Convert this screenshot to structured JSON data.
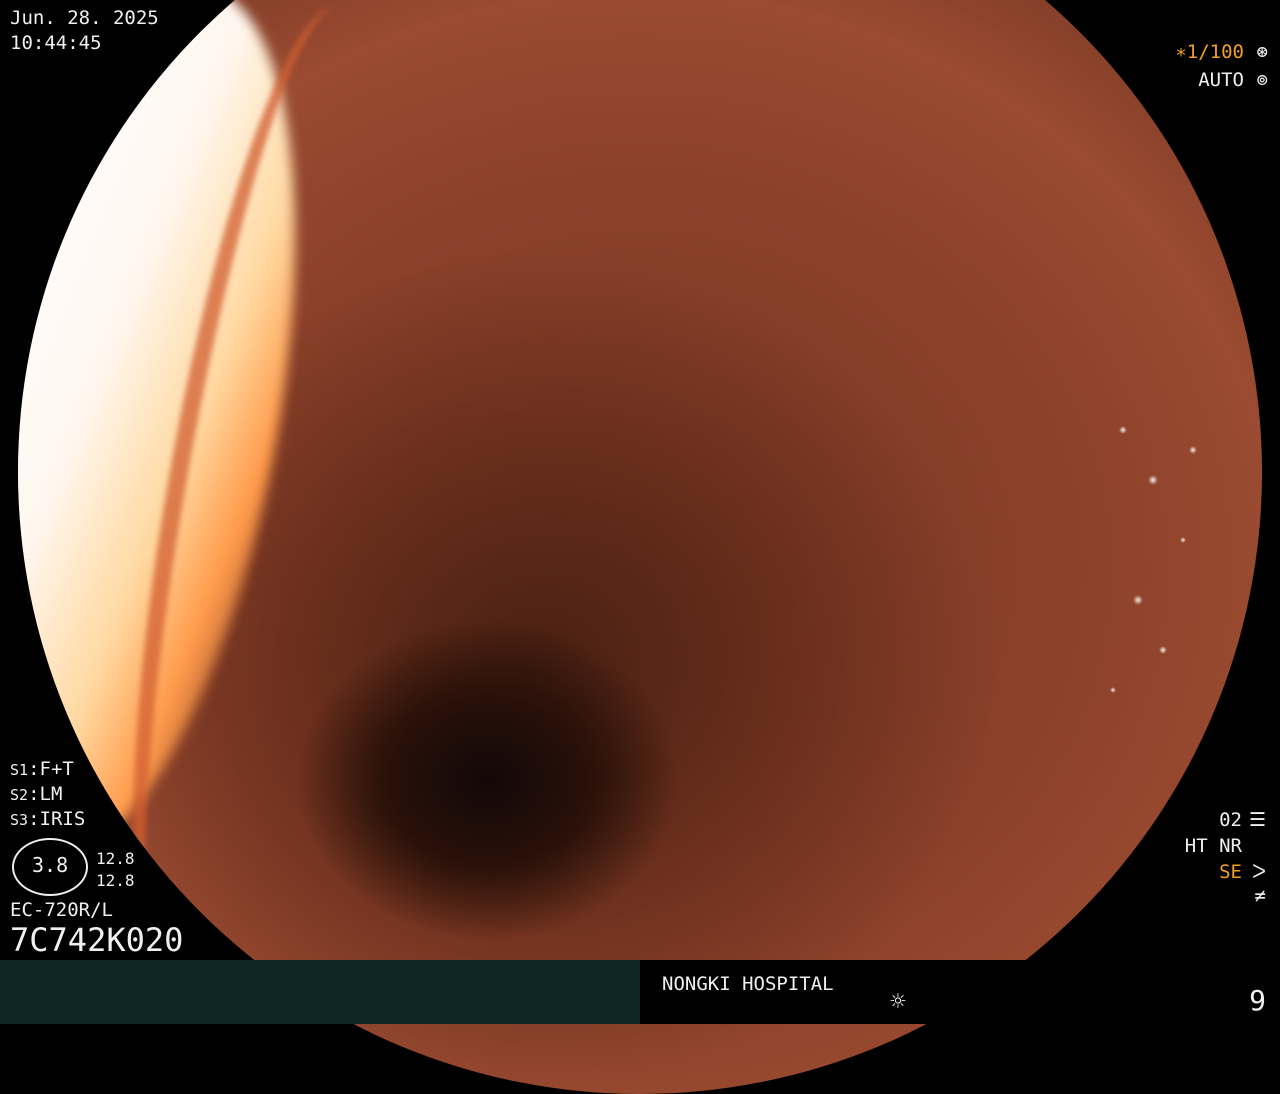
{
  "datetime": {
    "date": "Jun. 28. 2025",
    "time": "10:44:45"
  },
  "top_right": {
    "shutter": "∗1/100",
    "shutter_icon": "shutter-icon",
    "mode": "AUTO",
    "mode_icon": "iris-icon"
  },
  "settings": {
    "s1_key": "S1",
    "s1_val": "F+T",
    "s2_key": "S2",
    "s2_val": "LM",
    "s3_key": "S3",
    "s3_val": "IRIS"
  },
  "scope": {
    "ring_value": "3.8",
    "value_top": "12.8",
    "value_bottom": "12.8",
    "model": "EC-720R/L",
    "serial": "7C742K020"
  },
  "bottom_right": {
    "channel": "02",
    "channel_icon": "settings-sliders-icon",
    "ht_nr": "HT NR",
    "se": "SE",
    "se_icon": "enhance-icon",
    "strike_icon": "not-equal-icon"
  },
  "footer": {
    "hospital": "NONGKI HOSPITAL",
    "light_icon": "sun-icon",
    "index": "9"
  },
  "colors": {
    "overlay_text": "#f0f0f0",
    "highlight": "#f0a020",
    "footer_panel": "#0f2526"
  }
}
